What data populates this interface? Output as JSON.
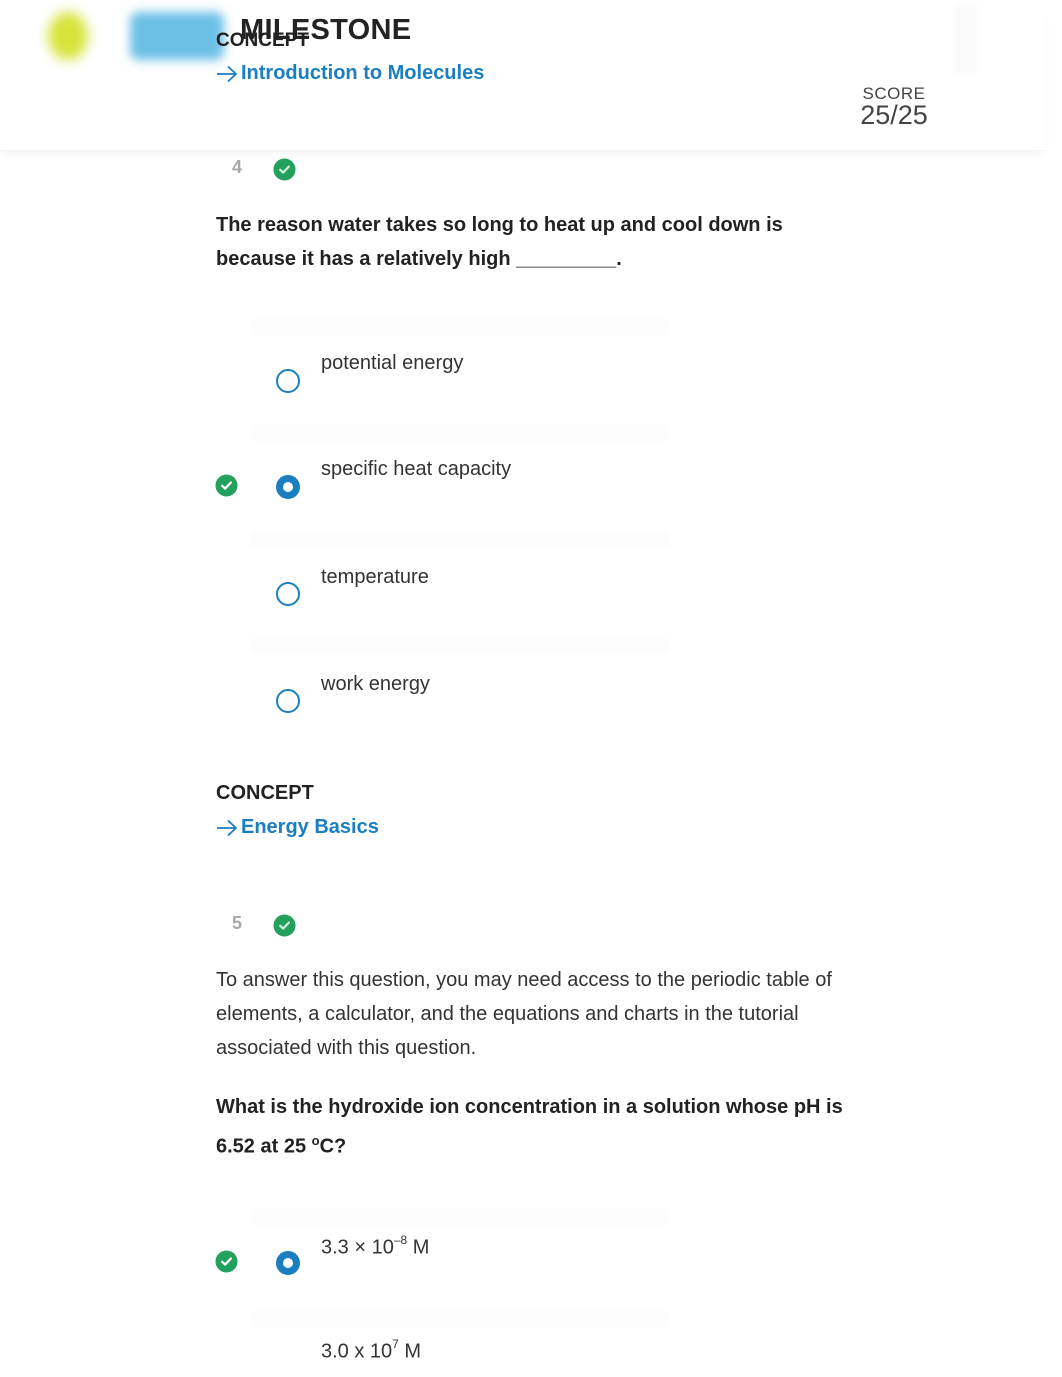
{
  "header": {
    "title": "MILESTONE",
    "concept_label": "CONCEPT",
    "concept_link": "Introduction to Molecules",
    "score_label": "SCORE",
    "score_value": "25/25"
  },
  "colors": {
    "accent": "#1a7ec0",
    "correct": "#23a05c",
    "text": "#222222",
    "muted": "#a8a8a8"
  },
  "questions": [
    {
      "number": "4",
      "status": "correct",
      "text": "The reason water takes so long to heat up and cool down is because it has a relatively high _________.",
      "options": [
        {
          "label": "potential energy",
          "selected": false,
          "correct": false
        },
        {
          "label": "specific heat capacity",
          "selected": true,
          "correct": true
        },
        {
          "label": "temperature",
          "selected": false,
          "correct": false
        },
        {
          "label": "work energy",
          "selected": false,
          "correct": false
        }
      ]
    },
    {
      "concept_label": "CONCEPT",
      "concept_link": "Energy Basics",
      "number": "5",
      "status": "correct",
      "intro": "To answer this question, you may need access to the periodic table of elements, a calculator, and the equations and charts in the tutorial associated with this question.",
      "text_before": "What is the hydroxide ion concentration in a solution whose pH is 6.52 at 25 ",
      "text_sup": "o",
      "text_after": "C?",
      "options": [
        {
          "base": "3.3 × 10",
          "exp": "–8",
          "unit": " M",
          "selected": true,
          "correct": true
        },
        {
          "base": "3.0 x 10",
          "exp": "7",
          "unit": " M",
          "selected": false,
          "correct": false
        }
      ]
    }
  ]
}
